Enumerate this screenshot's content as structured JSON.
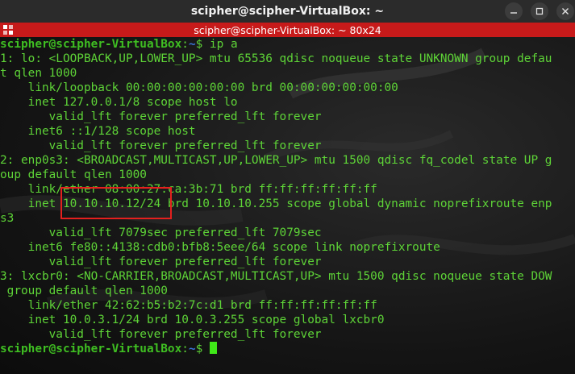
{
  "window": {
    "title": "scipher@scipher-VirtualBox: ~",
    "tab_title": "scipher@scipher-VirtualBox: ~ 80x24"
  },
  "terminal": {
    "user_host": "scipher@scipher-VirtualBox",
    "path": "~",
    "prompt_suffix": "$",
    "command": "ip a",
    "lines": [
      "1: lo: <LOOPBACK,UP,LOWER_UP> mtu 65536 qdisc noqueue state UNKNOWN group defau",
      "t qlen 1000",
      "    link/loopback 00:00:00:00:00:00 brd 00:00:00:00:00:00",
      "    inet 127.0.0.1/8 scope host lo",
      "       valid_lft forever preferred_lft forever",
      "    inet6 ::1/128 scope host",
      "       valid_lft forever preferred_lft forever",
      "2: enp0s3: <BROADCAST,MULTICAST,UP,LOWER_UP> mtu 1500 qdisc fq_codel state UP g",
      "oup default qlen 1000",
      "    link/ether 08:00:27:ca:3b:71 brd ff:ff:ff:ff:ff:ff",
      "    inet 10.10.10.12/24 brd 10.10.10.255 scope global dynamic noprefixroute enp",
      "s3",
      "       valid_lft 7079sec preferred_lft 7079sec",
      "    inet6 fe80::4138:cdb0:bfb8:5eee/64 scope link noprefixroute",
      "       valid_lft forever preferred_lft forever",
      "3: lxcbr0: <NO-CARRIER,BROADCAST,MULTICAST,UP> mtu 1500 qdisc noqueue state DOW",
      " group default qlen 1000",
      "    link/ether 42:62:b5:b2:7c:d1 brd ff:ff:ff:ff:ff:ff",
      "    inet 10.0.3.1/24 brd 10.0.3.255 scope global lxcbr0",
      "       valid_lft forever preferred_lft forever"
    ]
  },
  "colors": {
    "text": "#5ed437",
    "prompt": "#3fbf22",
    "path": "#3b74d9",
    "tab_bar": "#c71a1a",
    "highlight": "#e4201e"
  }
}
